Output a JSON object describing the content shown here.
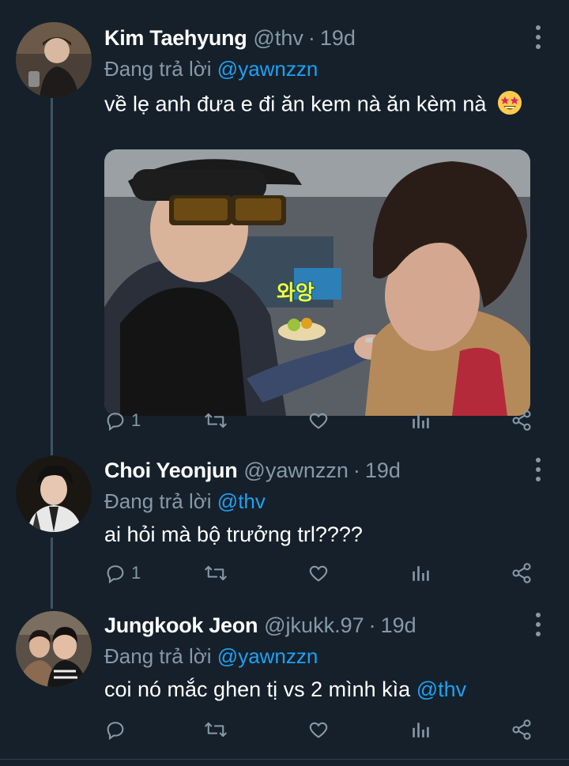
{
  "tweets": [
    {
      "name": "Kim Taehyung",
      "handle": "@thv",
      "time": "19d",
      "reply_prefix": "Đang trả lời",
      "reply_to": "@yawnzzn",
      "text": "về lẹ anh đưa e đi ăn kem nà ăn kèm nà",
      "emoji": "star-struck-emoji",
      "media_overlay_text": "와앙",
      "replies": "1",
      "retweets": "",
      "likes": ""
    },
    {
      "name": "Choi Yeonjun",
      "handle": "@yawnzzn",
      "time": "19d",
      "reply_prefix": "Đang trả lời",
      "reply_to": "@thv",
      "text": "ai hỏi mà bộ trưởng trl????",
      "replies": "1",
      "retweets": "",
      "likes": ""
    },
    {
      "name": "Jungkook Jeon",
      "handle": "@jkukk.97",
      "time": "19d",
      "reply_prefix": "Đang trả lời",
      "reply_to": "@yawnzzn",
      "text": "coi nó mắc ghen tị vs 2 mình kìa",
      "text_mention": "@thv",
      "replies": "",
      "retweets": "",
      "likes": ""
    }
  ],
  "colors": {
    "background": "#15202b",
    "secondary_text": "#8899a6",
    "link": "#1da1f2",
    "thread_line": "#3d5466"
  },
  "icons": [
    "reply-icon",
    "retweet-icon",
    "like-icon",
    "analytics-icon",
    "share-icon",
    "more-icon"
  ]
}
